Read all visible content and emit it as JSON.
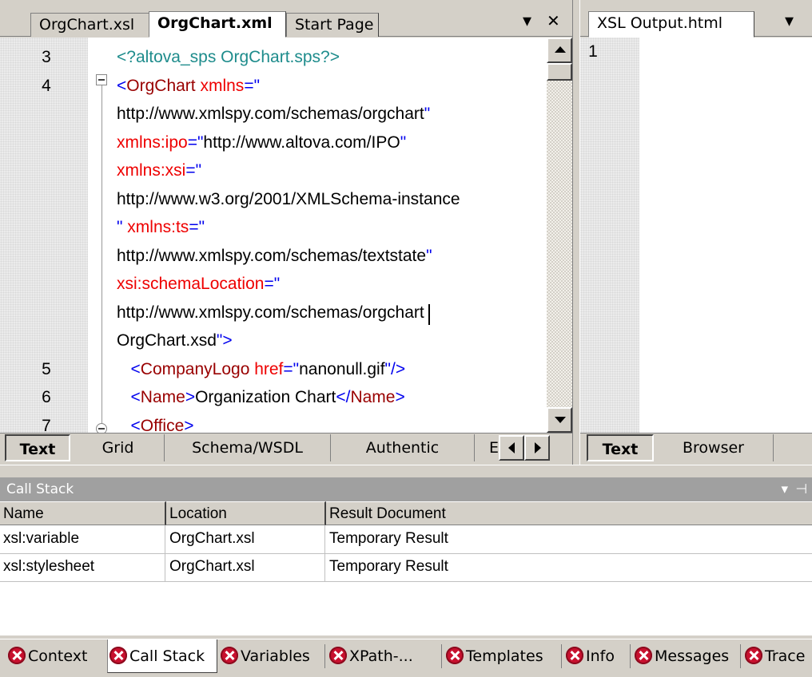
{
  "editor": {
    "tabs": [
      "OrgChart.xsl",
      "OrgChart.xml",
      "Start Page"
    ],
    "active_tab": "OrgChart.xml",
    "controls": {
      "dropdown": "▾",
      "close": "✕"
    },
    "lines": [
      {
        "num": "3",
        "segs": [
          {
            "t": "<?altova_sps OrgChart.sps?>",
            "c": "pi"
          }
        ]
      },
      {
        "num": "4",
        "segs": [
          {
            "t": "<",
            "c": "q"
          },
          {
            "t": "OrgChart",
            "c": "el"
          },
          {
            "t": " xmlns",
            "c": "attr"
          },
          {
            "t": "=\"",
            "c": "q"
          }
        ]
      },
      {
        "num": "",
        "segs": [
          {
            "t": "http://www.xmlspy.com/schemas/orgchart",
            "c": "tx"
          },
          {
            "t": "\"",
            "c": "q"
          }
        ]
      },
      {
        "num": "",
        "segs": [
          {
            "t": "xmlns:ipo",
            "c": "attr"
          },
          {
            "t": "=\"",
            "c": "q"
          },
          {
            "t": "http://www.altova.com/IPO",
            "c": "tx"
          },
          {
            "t": "\"",
            "c": "q"
          }
        ]
      },
      {
        "num": "",
        "segs": [
          {
            "t": "xmlns:xsi",
            "c": "attr"
          },
          {
            "t": "=\"",
            "c": "q"
          }
        ]
      },
      {
        "num": "",
        "segs": [
          {
            "t": "http://www.w3.org/2001/XMLSchema-instance",
            "c": "tx"
          }
        ]
      },
      {
        "num": "",
        "segs": [
          {
            "t": "\"",
            "c": "q"
          },
          {
            "t": " xmlns:ts",
            "c": "attr"
          },
          {
            "t": "=\"",
            "c": "q"
          }
        ]
      },
      {
        "num": "",
        "segs": [
          {
            "t": "http://www.xmlspy.com/schemas/textstate",
            "c": "tx"
          },
          {
            "t": "\"",
            "c": "q"
          }
        ]
      },
      {
        "num": "",
        "segs": [
          {
            "t": "xsi:schemaLocation",
            "c": "attr"
          },
          {
            "t": "=\"",
            "c": "q"
          }
        ]
      },
      {
        "num": "",
        "segs": [
          {
            "t": "http://www.xmlspy.com/schemas/orgchart",
            "c": "tx"
          }
        ]
      },
      {
        "num": "",
        "segs": [
          {
            "t": "OrgChart.xsd",
            "c": "tx"
          },
          {
            "t": "\">",
            "c": "q"
          }
        ]
      },
      {
        "num": "5",
        "segs": [
          {
            "t": "   <",
            "c": "q"
          },
          {
            "t": "CompanyLogo",
            "c": "el"
          },
          {
            "t": " href",
            "c": "attr"
          },
          {
            "t": "=\"",
            "c": "q"
          },
          {
            "t": "nanonull.gif",
            "c": "tx"
          },
          {
            "t": "\"/>",
            "c": "q"
          }
        ]
      },
      {
        "num": "6",
        "segs": [
          {
            "t": "   <",
            "c": "q"
          },
          {
            "t": "Name",
            "c": "el"
          },
          {
            "t": ">",
            "c": "q"
          },
          {
            "t": "Organization Chart",
            "c": "tx"
          },
          {
            "t": "</",
            "c": "q"
          },
          {
            "t": "Name",
            "c": "el"
          },
          {
            "t": ">",
            "c": "q"
          }
        ]
      },
      {
        "num": "7",
        "segs": [
          {
            "t": "   <",
            "c": "q"
          },
          {
            "t": "Office",
            "c": "el"
          },
          {
            "t": ">",
            "c": "q"
          }
        ]
      }
    ],
    "view_tabs": [
      "Text",
      "Grid",
      "Schema/WSDL",
      "Authentic",
      "E"
    ],
    "active_view": "Text"
  },
  "output": {
    "tab": "XSL Output.html",
    "line_number": "1",
    "view_tabs": [
      "Text",
      "Browser"
    ],
    "active_view": "Text"
  },
  "callstack": {
    "title": "Call Stack",
    "columns": [
      "Name",
      "Location",
      "Result Document"
    ],
    "rows": [
      [
        "xsl:variable",
        "OrgChart.xsl",
        "Temporary Result"
      ],
      [
        "xsl:stylesheet",
        "OrgChart.xsl",
        "Temporary Result"
      ]
    ],
    "controls": {
      "dropdown": "▾",
      "pin": "⊣"
    }
  },
  "bottom_tabs": [
    "Context",
    "Call Stack",
    "Variables",
    "XPath-...",
    "Templates",
    "Info",
    "Messages",
    "Trace"
  ],
  "active_bottom_tab": "Call Stack",
  "colors": {
    "processing_instruction": "#1e8c8c",
    "element": "#990000",
    "attribute": "#ee0000",
    "punctuation": "#0000ee",
    "text": "#000000",
    "panel_bg": "#d4d0c8",
    "panel_title_bg": "#a0a0a0",
    "error_icon": "#c8102e"
  }
}
